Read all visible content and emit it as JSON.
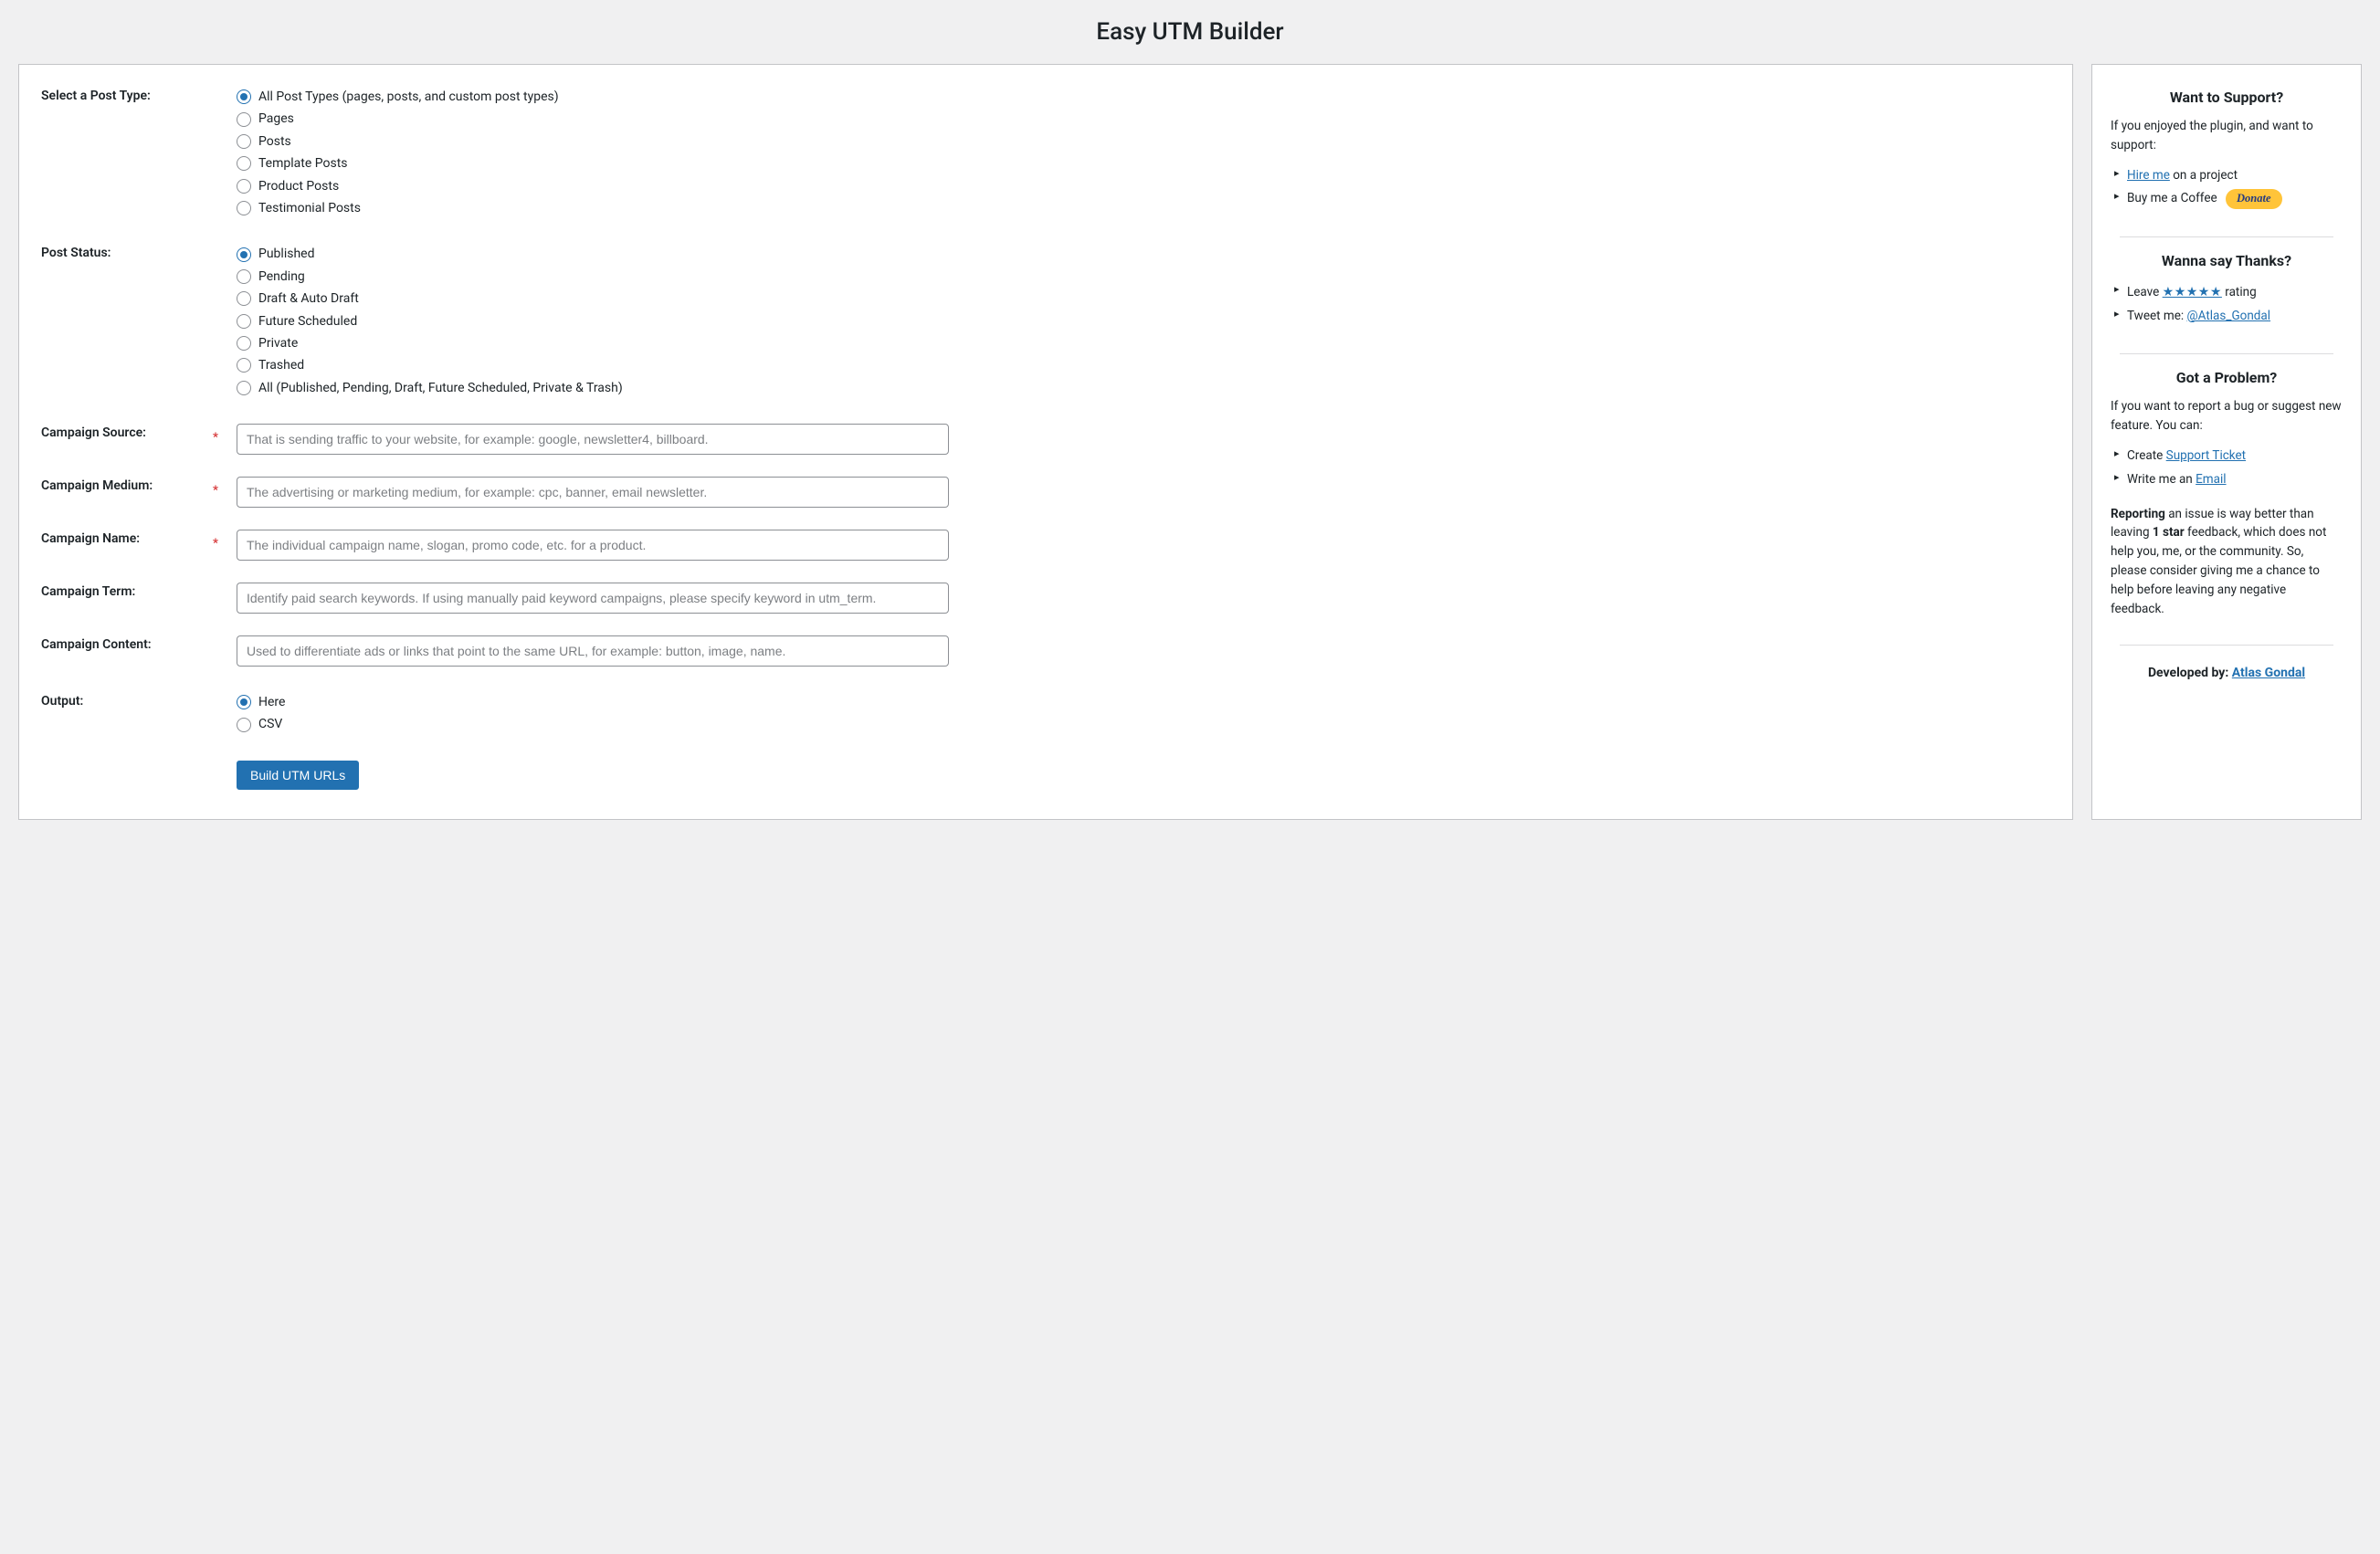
{
  "page": {
    "title": "Easy UTM Builder"
  },
  "form": {
    "post_type": {
      "label": "Select a Post Type:",
      "selected": 0,
      "options": [
        "All Post Types (pages, posts, and custom post types)",
        "Pages",
        "Posts",
        "Template Posts",
        "Product Posts",
        "Testimonial Posts"
      ]
    },
    "post_status": {
      "label": "Post Status:",
      "selected": 0,
      "options": [
        "Published",
        "Pending",
        "Draft & Auto Draft",
        "Future Scheduled",
        "Private",
        "Trashed",
        "All (Published, Pending, Draft, Future Scheduled, Private & Trash)"
      ]
    },
    "campaign_source": {
      "label": "Campaign Source:",
      "required": "*",
      "placeholder": "That is sending traffic to your website, for example: google, newsletter4, billboard."
    },
    "campaign_medium": {
      "label": "Campaign Medium:",
      "required": "*",
      "placeholder": "The advertising or marketing medium, for example: cpc, banner, email newsletter."
    },
    "campaign_name": {
      "label": "Campaign Name:",
      "required": "*",
      "placeholder": "The individual campaign name, slogan, promo code, etc. for a product."
    },
    "campaign_term": {
      "label": "Campaign Term:",
      "placeholder": "Identify paid search keywords. If using manually paid keyword campaigns, please specify keyword in utm_term."
    },
    "campaign_content": {
      "label": "Campaign Content:",
      "placeholder": "Used to differentiate ads or links that point to the same URL, for example: button, image, name."
    },
    "output": {
      "label": "Output:",
      "selected": 0,
      "options": [
        "Here",
        "CSV"
      ]
    },
    "submit_label": "Build UTM URLs"
  },
  "sidebar": {
    "support": {
      "title": "Want to Support?",
      "intro": "If you enjoyed the plugin, and want to support:",
      "hire_link": "Hire me",
      "hire_suffix": " on a project",
      "coffee_prefix": "Buy me a Coffee ",
      "donate_label": "Donate"
    },
    "thanks": {
      "title": "Wanna say Thanks?",
      "leave_prefix": "Leave ",
      "stars": "★★★★★",
      "leave_suffix": " rating",
      "tweet_prefix": "Tweet me: ",
      "tweet_handle": "@Atlas_Gondal"
    },
    "problem": {
      "title": "Got a Problem?",
      "intro": "If you want to report a bug or suggest new feature. You can:",
      "create_prefix": "Create ",
      "create_link": "Support Ticket",
      "write_prefix": "Write me an ",
      "write_link": "Email",
      "note_bold1": "Reporting",
      "note_mid1": " an issue is way better than leaving ",
      "note_bold2": "1 star",
      "note_tail": " feedback, which does not help you, me, or the community. So, please consider giving me a chance to help before leaving any negative feedback."
    },
    "developed": {
      "prefix": "Developed by: ",
      "name": "Atlas Gondal"
    }
  }
}
